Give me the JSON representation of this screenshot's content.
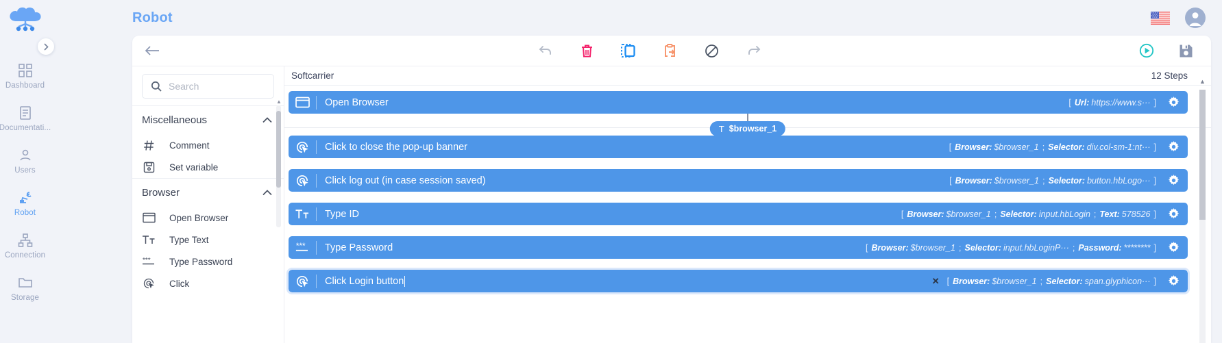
{
  "sidebar": {
    "logo": "cloud-robot-logo",
    "expand_icon": "chevron-right-icon",
    "items": [
      {
        "label": "Dashboard",
        "icon": "dashboard-icon",
        "active": false
      },
      {
        "label": "Documentati...",
        "icon": "document-icon",
        "active": false
      },
      {
        "label": "Users",
        "icon": "user-icon",
        "active": false
      },
      {
        "label": "Robot",
        "icon": "robot-arm-icon",
        "active": true
      },
      {
        "label": "Connection",
        "icon": "sitemap-icon",
        "active": false
      },
      {
        "label": "Storage",
        "icon": "folder-icon",
        "active": false
      }
    ]
  },
  "header": {
    "title": "Robot",
    "flag": "us-flag-icon",
    "avatar": "user-avatar-icon"
  },
  "toolbar": {
    "back": "back-arrow-icon",
    "buttons": [
      {
        "name": "undo-button",
        "icon": "undo-icon",
        "color": "#b5bcc9"
      },
      {
        "name": "delete-button",
        "icon": "trash-icon",
        "color": "#f4246c"
      },
      {
        "name": "copy-button",
        "icon": "copy-icon",
        "color": "#1d8df2"
      },
      {
        "name": "paste-button",
        "icon": "paste-icon",
        "color": "#f7936a"
      },
      {
        "name": "disable-button",
        "icon": "block-icon",
        "color": "#4b5565"
      },
      {
        "name": "redo-button",
        "icon": "redo-icon",
        "color": "#b5bcc9"
      }
    ],
    "run": {
      "name": "run-button",
      "icon": "play-circle-icon",
      "color": "#24c6c6"
    },
    "save": {
      "name": "save-button",
      "icon": "floppy-disk-icon",
      "color": "#8c98b3"
    }
  },
  "palette": {
    "search": {
      "value": "",
      "placeholder": "Search",
      "icon": "search-icon"
    },
    "groups": [
      {
        "title": "Miscellaneous",
        "collapse_icon": "chevron-up-icon",
        "items": [
          {
            "label": "Comment",
            "icon": "hash-icon"
          },
          {
            "label": "Set variable",
            "icon": "save-variable-icon"
          }
        ]
      },
      {
        "title": "Browser",
        "collapse_icon": "chevron-up-icon",
        "items": [
          {
            "label": "Open Browser",
            "icon": "browser-window-icon"
          },
          {
            "label": "Type Text",
            "icon": "type-text-icon"
          },
          {
            "label": "Type Password",
            "icon": "type-password-icon"
          },
          {
            "label": "Click",
            "icon": "click-target-icon"
          }
        ]
      }
    ]
  },
  "canvas": {
    "title": "Softcarrier",
    "steps_count": "12 Steps",
    "variable_pill": {
      "symbol": "T",
      "label": "$browser_1"
    },
    "steps": [
      {
        "label": "Open Browser",
        "icon": "browser-window-icon",
        "selected": false,
        "editing": false,
        "marked": false,
        "meta": [
          {
            "key": "Url:",
            "value": "https://www.s···"
          }
        ]
      },
      {
        "label": "Click to close the pop-up banner",
        "icon": "click-target-icon",
        "selected": false,
        "editing": false,
        "marked": false,
        "meta": [
          {
            "key": "Browser:",
            "value": "$browser_1"
          },
          {
            "key": "Selector:",
            "value": "div.col-sm-1:nt···"
          }
        ]
      },
      {
        "label": "Click log out (in case session saved)",
        "icon": "click-target-icon",
        "selected": false,
        "editing": false,
        "marked": false,
        "meta": [
          {
            "key": "Browser:",
            "value": "$browser_1"
          },
          {
            "key": "Selector:",
            "value": "button.hbLogo···"
          }
        ]
      },
      {
        "label": "Type ID",
        "icon": "type-text-icon",
        "selected": false,
        "editing": false,
        "marked": false,
        "meta": [
          {
            "key": "Browser:",
            "value": "$browser_1"
          },
          {
            "key": "Selector:",
            "value": "input.hbLogin"
          },
          {
            "key": "Text:",
            "value": "578526"
          }
        ]
      },
      {
        "label": "Type Password",
        "icon": "type-password-icon",
        "selected": false,
        "editing": false,
        "marked": false,
        "meta": [
          {
            "key": "Browser:",
            "value": "$browser_1"
          },
          {
            "key": "Selector:",
            "value": "input.hbLoginP···"
          },
          {
            "key": "Password:",
            "value": "********"
          }
        ]
      },
      {
        "label": "Click Login button",
        "icon": "click-target-icon",
        "selected": true,
        "editing": true,
        "marked": true,
        "marker": "✕",
        "meta": [
          {
            "key": "Browser:",
            "value": "$browser_1"
          },
          {
            "key": "Selector:",
            "value": "span.glyphicon···"
          }
        ]
      }
    ]
  },
  "colors": {
    "accent_blue": "#4e96e8",
    "title_blue": "#6aa6f5",
    "page_bg": "#f1f3f8",
    "rail_inactive": "#9aa5bf"
  }
}
